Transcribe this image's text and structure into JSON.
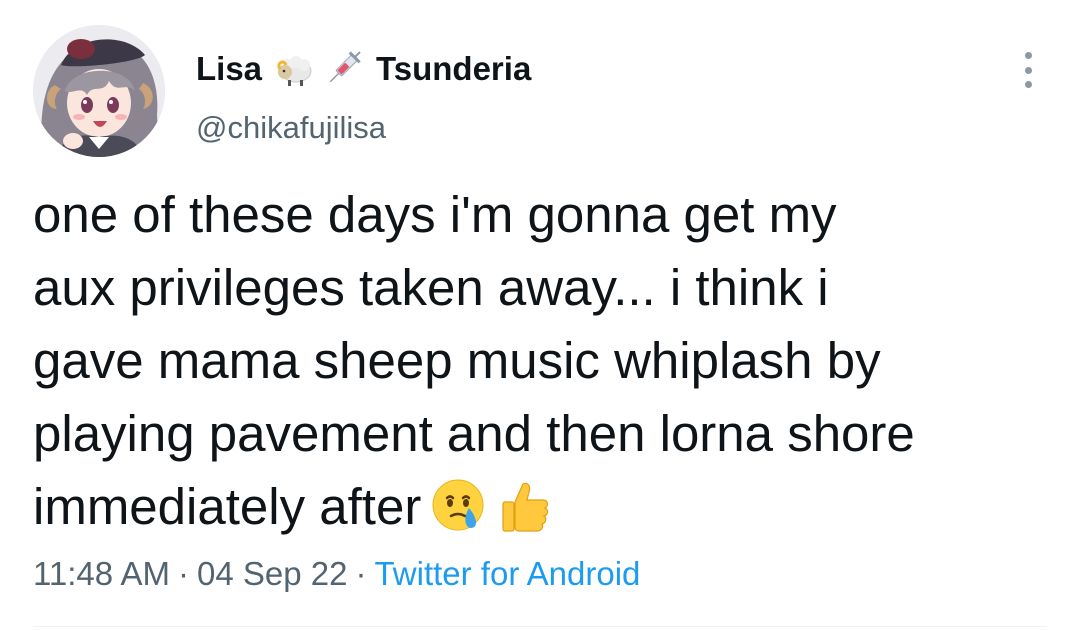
{
  "author": {
    "display_name": "Lisa",
    "name_emojis": [
      "sheep-icon",
      "syringe-icon"
    ],
    "display_name_suffix": "Tsunderia",
    "handle": "@chikafujilisa",
    "avatar": "anime-avatar"
  },
  "tweet": {
    "lines": [
      "one of these days i'm gonna get my",
      "aux privileges taken away... i think i",
      "gave mama sheep music whiplash by",
      "playing pavement and then lorna shore",
      "immediately after"
    ],
    "trailing_emojis": [
      "face-holding-back-tears-icon",
      "thumbs-up-icon"
    ]
  },
  "meta": {
    "time": "11:48 AM",
    "separator": "·",
    "date": "04 Sep 22",
    "source": "Twitter for Android"
  },
  "colors": {
    "text": "#0f1419",
    "secondary": "#536471",
    "link": "#1d9bf0",
    "divider": "#eff3f4"
  }
}
